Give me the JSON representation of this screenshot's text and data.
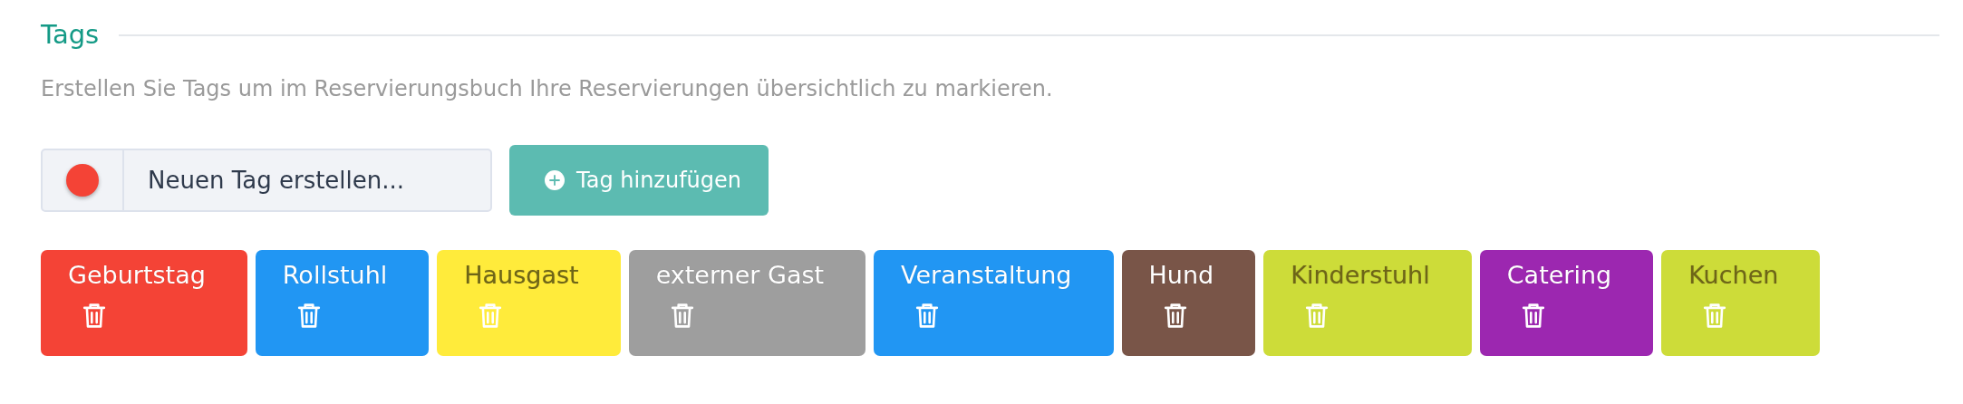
{
  "section": {
    "title": "Tags",
    "description": "Erstellen Sie Tags um im Reservierungsbuch Ihre Reservierungen übersichtlich zu markieren."
  },
  "new_tag": {
    "color": "#f44336",
    "placeholder": "Neuen Tag erstellen...",
    "button": "Tag hinzufügen"
  },
  "tags": [
    {
      "label": "Geburtstag",
      "color": "#f44336"
    },
    {
      "label": "Rollstuhl",
      "color": "#2196f3"
    },
    {
      "label": "Hausgast",
      "color": "#ffeb3b"
    },
    {
      "label": "externer Gast",
      "color": "#9e9e9e"
    },
    {
      "label": "Veranstaltung",
      "color": "#2196f3"
    },
    {
      "label": "Hund",
      "color": "#795548"
    },
    {
      "label": "Kinderstuhl",
      "color": "#cddc39"
    },
    {
      "label": "Catering",
      "color": "#9c27b0"
    },
    {
      "label": "Kuchen",
      "color": "#cddc39"
    }
  ]
}
